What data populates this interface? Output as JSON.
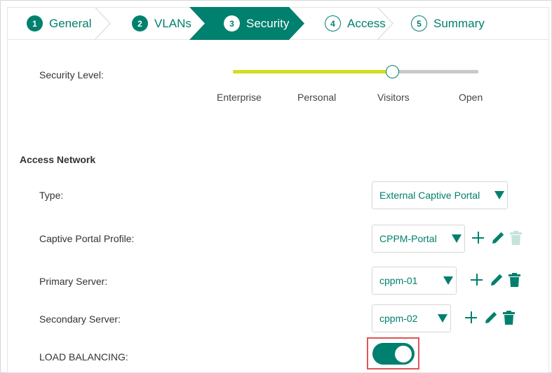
{
  "wizard": {
    "steps": [
      {
        "num": "1",
        "label": "General",
        "state": "done"
      },
      {
        "num": "2",
        "label": "VLANs",
        "state": "done"
      },
      {
        "num": "3",
        "label": "Security",
        "state": "active"
      },
      {
        "num": "4",
        "label": "Access",
        "state": "todo"
      },
      {
        "num": "5",
        "label": "Summary",
        "state": "todo"
      }
    ]
  },
  "security": {
    "label": "Security Level:",
    "levels": [
      "Enterprise",
      "Personal",
      "Visitors",
      "Open"
    ],
    "selected": "Visitors",
    "selected_fraction": 0.65
  },
  "access_network": {
    "title": "Access Network",
    "type": {
      "label": "Type:",
      "value": "External Captive Portal"
    },
    "captive_portal_profile": {
      "label": "Captive Portal Profile:",
      "value": "CPPM-Portal",
      "delete_enabled": false
    },
    "primary_server": {
      "label": "Primary Server:",
      "value": "cppm-01",
      "delete_enabled": true
    },
    "secondary_server": {
      "label": "Secondary Server:",
      "value": "cppm-02",
      "delete_enabled": true
    },
    "load_balancing": {
      "label": "LOAD BALANCING:",
      "enabled": true
    }
  },
  "colors": {
    "accent": "#00806e",
    "slider_fill": "#d3de1e",
    "highlight_box": "#e05555"
  }
}
